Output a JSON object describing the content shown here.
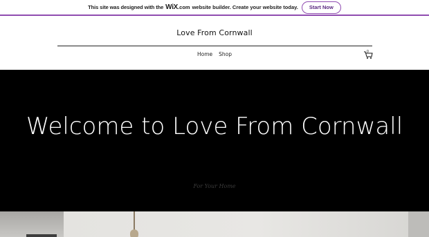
{
  "wix_banner": {
    "text_before": "This site was designed with the",
    "logo": "WiX",
    "logo_suffix": ".com",
    "text_after": "website builder. Create your website today.",
    "button_label": "Start Now",
    "accent_color": "#8f4bb0"
  },
  "header": {
    "site_title": "Love From Cornwall",
    "nav": [
      {
        "label": "Home"
      },
      {
        "label": "Shop"
      }
    ],
    "cart_count": "0",
    "cart_icon": "shopping-cart-icon"
  },
  "hero": {
    "title": "Welcome to Love From Cornwall",
    "subtitle": "For Your Home",
    "background_color": "#000000"
  }
}
